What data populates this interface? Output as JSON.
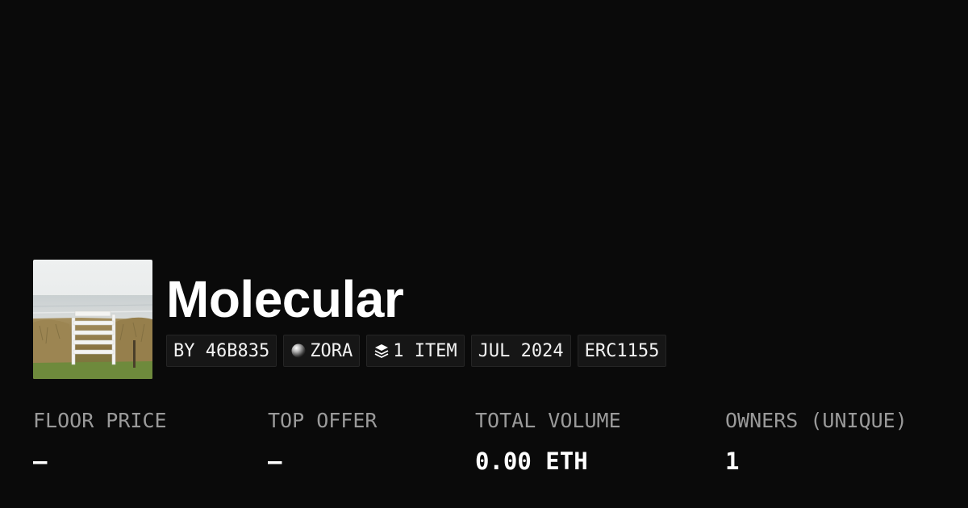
{
  "collection": {
    "title": "Molecular",
    "image_alt": "white wooden stairs on a grassy dune facing the sea"
  },
  "tags": [
    {
      "label": "BY 46B835",
      "icon": null
    },
    {
      "label": "ZORA",
      "icon": "zora-orb-icon"
    },
    {
      "label": "1 ITEM",
      "icon": "layers-icon"
    },
    {
      "label": "JUL 2024",
      "icon": null
    },
    {
      "label": "ERC1155",
      "icon": null
    }
  ],
  "stats": [
    {
      "label": "FLOOR PRICE",
      "value": "–"
    },
    {
      "label": "TOP OFFER",
      "value": "–"
    },
    {
      "label": "TOTAL VOLUME",
      "value": "0.00 ETH"
    },
    {
      "label": "OWNERS (UNIQUE)",
      "value": "1"
    }
  ],
  "colors": {
    "background": "#0a0a0a",
    "tag_background": "#161616",
    "label_gray": "#9a9a9a",
    "text": "#ffffff"
  }
}
